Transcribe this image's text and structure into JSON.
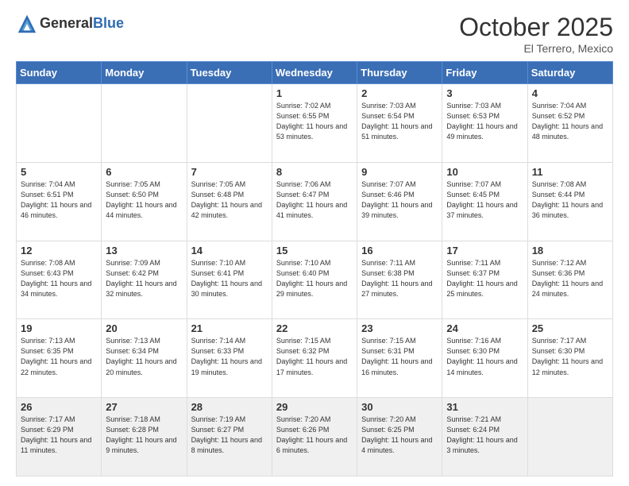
{
  "header": {
    "logo_general": "General",
    "logo_blue": "Blue",
    "month_title": "October 2025",
    "subtitle": "El Terrero, Mexico"
  },
  "weekdays": [
    "Sunday",
    "Monday",
    "Tuesday",
    "Wednesday",
    "Thursday",
    "Friday",
    "Saturday"
  ],
  "weeks": [
    [
      {
        "day": "",
        "info": ""
      },
      {
        "day": "",
        "info": ""
      },
      {
        "day": "",
        "info": ""
      },
      {
        "day": "1",
        "info": "Sunrise: 7:02 AM\nSunset: 6:55 PM\nDaylight: 11 hours\nand 53 minutes."
      },
      {
        "day": "2",
        "info": "Sunrise: 7:03 AM\nSunset: 6:54 PM\nDaylight: 11 hours\nand 51 minutes."
      },
      {
        "day": "3",
        "info": "Sunrise: 7:03 AM\nSunset: 6:53 PM\nDaylight: 11 hours\nand 49 minutes."
      },
      {
        "day": "4",
        "info": "Sunrise: 7:04 AM\nSunset: 6:52 PM\nDaylight: 11 hours\nand 48 minutes."
      }
    ],
    [
      {
        "day": "5",
        "info": "Sunrise: 7:04 AM\nSunset: 6:51 PM\nDaylight: 11 hours\nand 46 minutes."
      },
      {
        "day": "6",
        "info": "Sunrise: 7:05 AM\nSunset: 6:50 PM\nDaylight: 11 hours\nand 44 minutes."
      },
      {
        "day": "7",
        "info": "Sunrise: 7:05 AM\nSunset: 6:48 PM\nDaylight: 11 hours\nand 42 minutes."
      },
      {
        "day": "8",
        "info": "Sunrise: 7:06 AM\nSunset: 6:47 PM\nDaylight: 11 hours\nand 41 minutes."
      },
      {
        "day": "9",
        "info": "Sunrise: 7:07 AM\nSunset: 6:46 PM\nDaylight: 11 hours\nand 39 minutes."
      },
      {
        "day": "10",
        "info": "Sunrise: 7:07 AM\nSunset: 6:45 PM\nDaylight: 11 hours\nand 37 minutes."
      },
      {
        "day": "11",
        "info": "Sunrise: 7:08 AM\nSunset: 6:44 PM\nDaylight: 11 hours\nand 36 minutes."
      }
    ],
    [
      {
        "day": "12",
        "info": "Sunrise: 7:08 AM\nSunset: 6:43 PM\nDaylight: 11 hours\nand 34 minutes."
      },
      {
        "day": "13",
        "info": "Sunrise: 7:09 AM\nSunset: 6:42 PM\nDaylight: 11 hours\nand 32 minutes."
      },
      {
        "day": "14",
        "info": "Sunrise: 7:10 AM\nSunset: 6:41 PM\nDaylight: 11 hours\nand 30 minutes."
      },
      {
        "day": "15",
        "info": "Sunrise: 7:10 AM\nSunset: 6:40 PM\nDaylight: 11 hours\nand 29 minutes."
      },
      {
        "day": "16",
        "info": "Sunrise: 7:11 AM\nSunset: 6:38 PM\nDaylight: 11 hours\nand 27 minutes."
      },
      {
        "day": "17",
        "info": "Sunrise: 7:11 AM\nSunset: 6:37 PM\nDaylight: 11 hours\nand 25 minutes."
      },
      {
        "day": "18",
        "info": "Sunrise: 7:12 AM\nSunset: 6:36 PM\nDaylight: 11 hours\nand 24 minutes."
      }
    ],
    [
      {
        "day": "19",
        "info": "Sunrise: 7:13 AM\nSunset: 6:35 PM\nDaylight: 11 hours\nand 22 minutes."
      },
      {
        "day": "20",
        "info": "Sunrise: 7:13 AM\nSunset: 6:34 PM\nDaylight: 11 hours\nand 20 minutes."
      },
      {
        "day": "21",
        "info": "Sunrise: 7:14 AM\nSunset: 6:33 PM\nDaylight: 11 hours\nand 19 minutes."
      },
      {
        "day": "22",
        "info": "Sunrise: 7:15 AM\nSunset: 6:32 PM\nDaylight: 11 hours\nand 17 minutes."
      },
      {
        "day": "23",
        "info": "Sunrise: 7:15 AM\nSunset: 6:31 PM\nDaylight: 11 hours\nand 16 minutes."
      },
      {
        "day": "24",
        "info": "Sunrise: 7:16 AM\nSunset: 6:30 PM\nDaylight: 11 hours\nand 14 minutes."
      },
      {
        "day": "25",
        "info": "Sunrise: 7:17 AM\nSunset: 6:30 PM\nDaylight: 11 hours\nand 12 minutes."
      }
    ],
    [
      {
        "day": "26",
        "info": "Sunrise: 7:17 AM\nSunset: 6:29 PM\nDaylight: 11 hours\nand 11 minutes."
      },
      {
        "day": "27",
        "info": "Sunrise: 7:18 AM\nSunset: 6:28 PM\nDaylight: 11 hours\nand 9 minutes."
      },
      {
        "day": "28",
        "info": "Sunrise: 7:19 AM\nSunset: 6:27 PM\nDaylight: 11 hours\nand 8 minutes."
      },
      {
        "day": "29",
        "info": "Sunrise: 7:20 AM\nSunset: 6:26 PM\nDaylight: 11 hours\nand 6 minutes."
      },
      {
        "day": "30",
        "info": "Sunrise: 7:20 AM\nSunset: 6:25 PM\nDaylight: 11 hours\nand 4 minutes."
      },
      {
        "day": "31",
        "info": "Sunrise: 7:21 AM\nSunset: 6:24 PM\nDaylight: 11 hours\nand 3 minutes."
      },
      {
        "day": "",
        "info": ""
      }
    ]
  ]
}
